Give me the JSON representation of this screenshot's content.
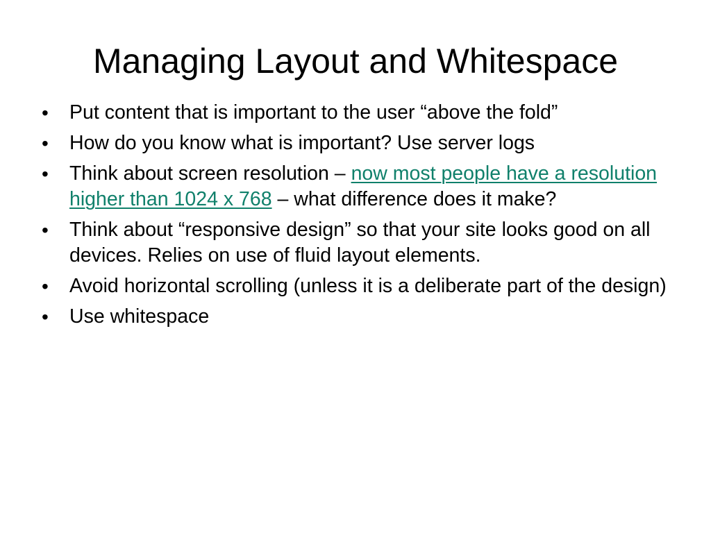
{
  "slide": {
    "title": "Managing Layout and Whitespace",
    "bullet_glyph": "•",
    "link_color": "#10806b",
    "bullets": [
      {
        "text": "Put content that is important to the user “above the fold”"
      },
      {
        "text": "How do you know what is important? Use server logs"
      },
      {
        "before": "Think about screen resolution – ",
        "link": "now most people have a resolution higher than 1024 x 768",
        "after": " – what difference does it make?"
      },
      {
        "text": "Think about “responsive design” so that your site looks good on all devices. Relies on use of fluid layout elements."
      },
      {
        "text": "Avoid horizontal scrolling (unless it is a deliberate part of the design)"
      },
      {
        "text": "Use whitespace"
      }
    ]
  }
}
